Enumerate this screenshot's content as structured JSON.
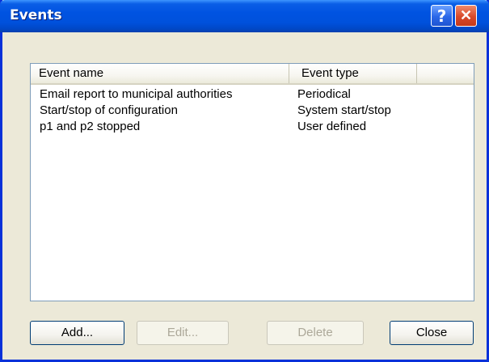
{
  "window": {
    "title": "Events"
  },
  "titlebar_buttons": {
    "help": "?",
    "close": "✕"
  },
  "list": {
    "columns": [
      "Event name",
      "Event type"
    ],
    "rows": [
      {
        "name": "Email report to municipal authorities",
        "type": "Periodical"
      },
      {
        "name": "Start/stop of configuration",
        "type": "System start/stop"
      },
      {
        "name": "p1 and p2 stopped",
        "type": "User defined"
      }
    ]
  },
  "buttons": {
    "add": "Add...",
    "edit": "Edit...",
    "delete": "Delete",
    "close": "Close"
  }
}
